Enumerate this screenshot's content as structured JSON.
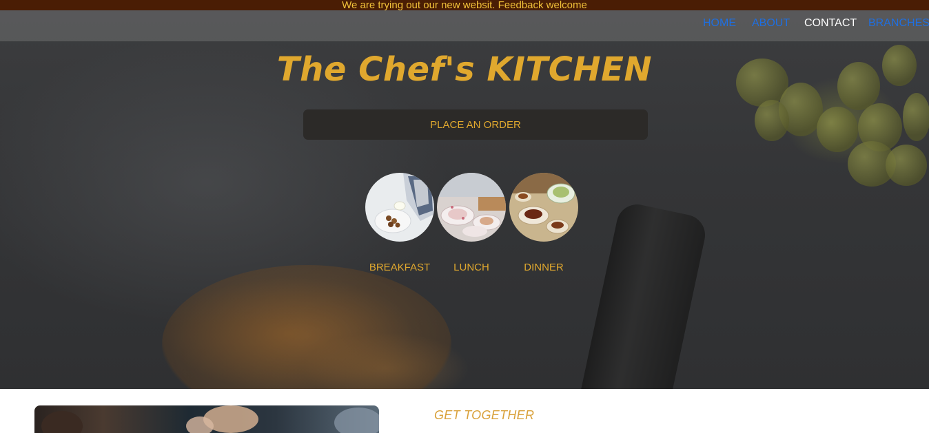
{
  "announcement": "We are trying out our new websit. Feedback welcome",
  "nav": {
    "items": [
      {
        "label": "HOME"
      },
      {
        "label": "ABOUT"
      },
      {
        "label": "CONTACT"
      },
      {
        "label": "BRANCHES"
      }
    ]
  },
  "hero": {
    "title": "The Chef's KITCHEN",
    "order_button": "PLACE AN ORDER",
    "meals": [
      {
        "label": "BREAKFAST"
      },
      {
        "label": "LUNCH"
      },
      {
        "label": "DINNER"
      }
    ]
  },
  "section": {
    "heading": "GET TOGETHER"
  },
  "colors": {
    "accent": "#e0a82e",
    "banner": "#4a1d04",
    "link": "#1f6fe0"
  }
}
